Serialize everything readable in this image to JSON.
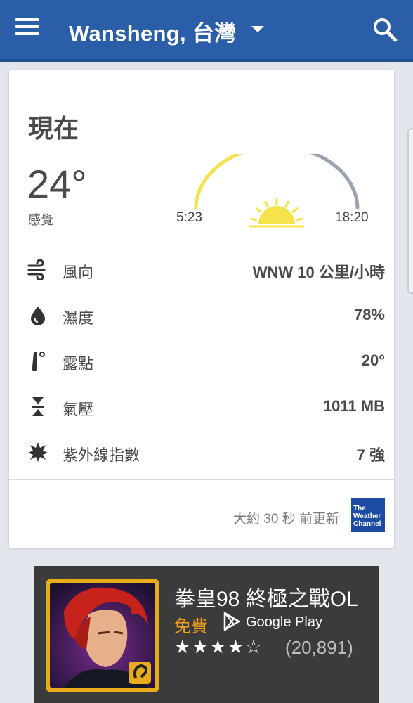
{
  "appbar": {
    "location": "Wansheng, 台灣"
  },
  "current": {
    "heading": "現在",
    "temperature": "24°",
    "feels_label": "感覺",
    "sunrise": "5:23",
    "sunset": "18:20",
    "sun_progress": 0.45
  },
  "details": [
    {
      "label": "風向",
      "value": "WNW 10 公里/小時",
      "icon": "wind-icon"
    },
    {
      "label": "濕度",
      "value": "78%",
      "icon": "humidity-icon"
    },
    {
      "label": "露點",
      "value": "20°",
      "icon": "dew-point-icon"
    },
    {
      "label": "氣壓",
      "value": "1011 MB",
      "icon": "pressure-icon"
    },
    {
      "label": "紫外線指數",
      "value": "7 強",
      "icon": "uv-index-icon"
    }
  ],
  "footer": {
    "updated": "大約 30 秒 前更新",
    "provider_logo_lines": [
      "The",
      "Weather",
      "Channel"
    ]
  },
  "ad": {
    "title": "拳皇98 終極之戰OL",
    "price": "免費",
    "store": "Google Play",
    "stars": "★★★★☆",
    "rating_value": 4,
    "reviews": "(20,891)"
  },
  "colors": {
    "appbar": "#2a5ea8",
    "sun_arc_done": "#f4e34c",
    "sun_arc_remaining": "#9aa4ae",
    "price": "#f2a11f"
  }
}
